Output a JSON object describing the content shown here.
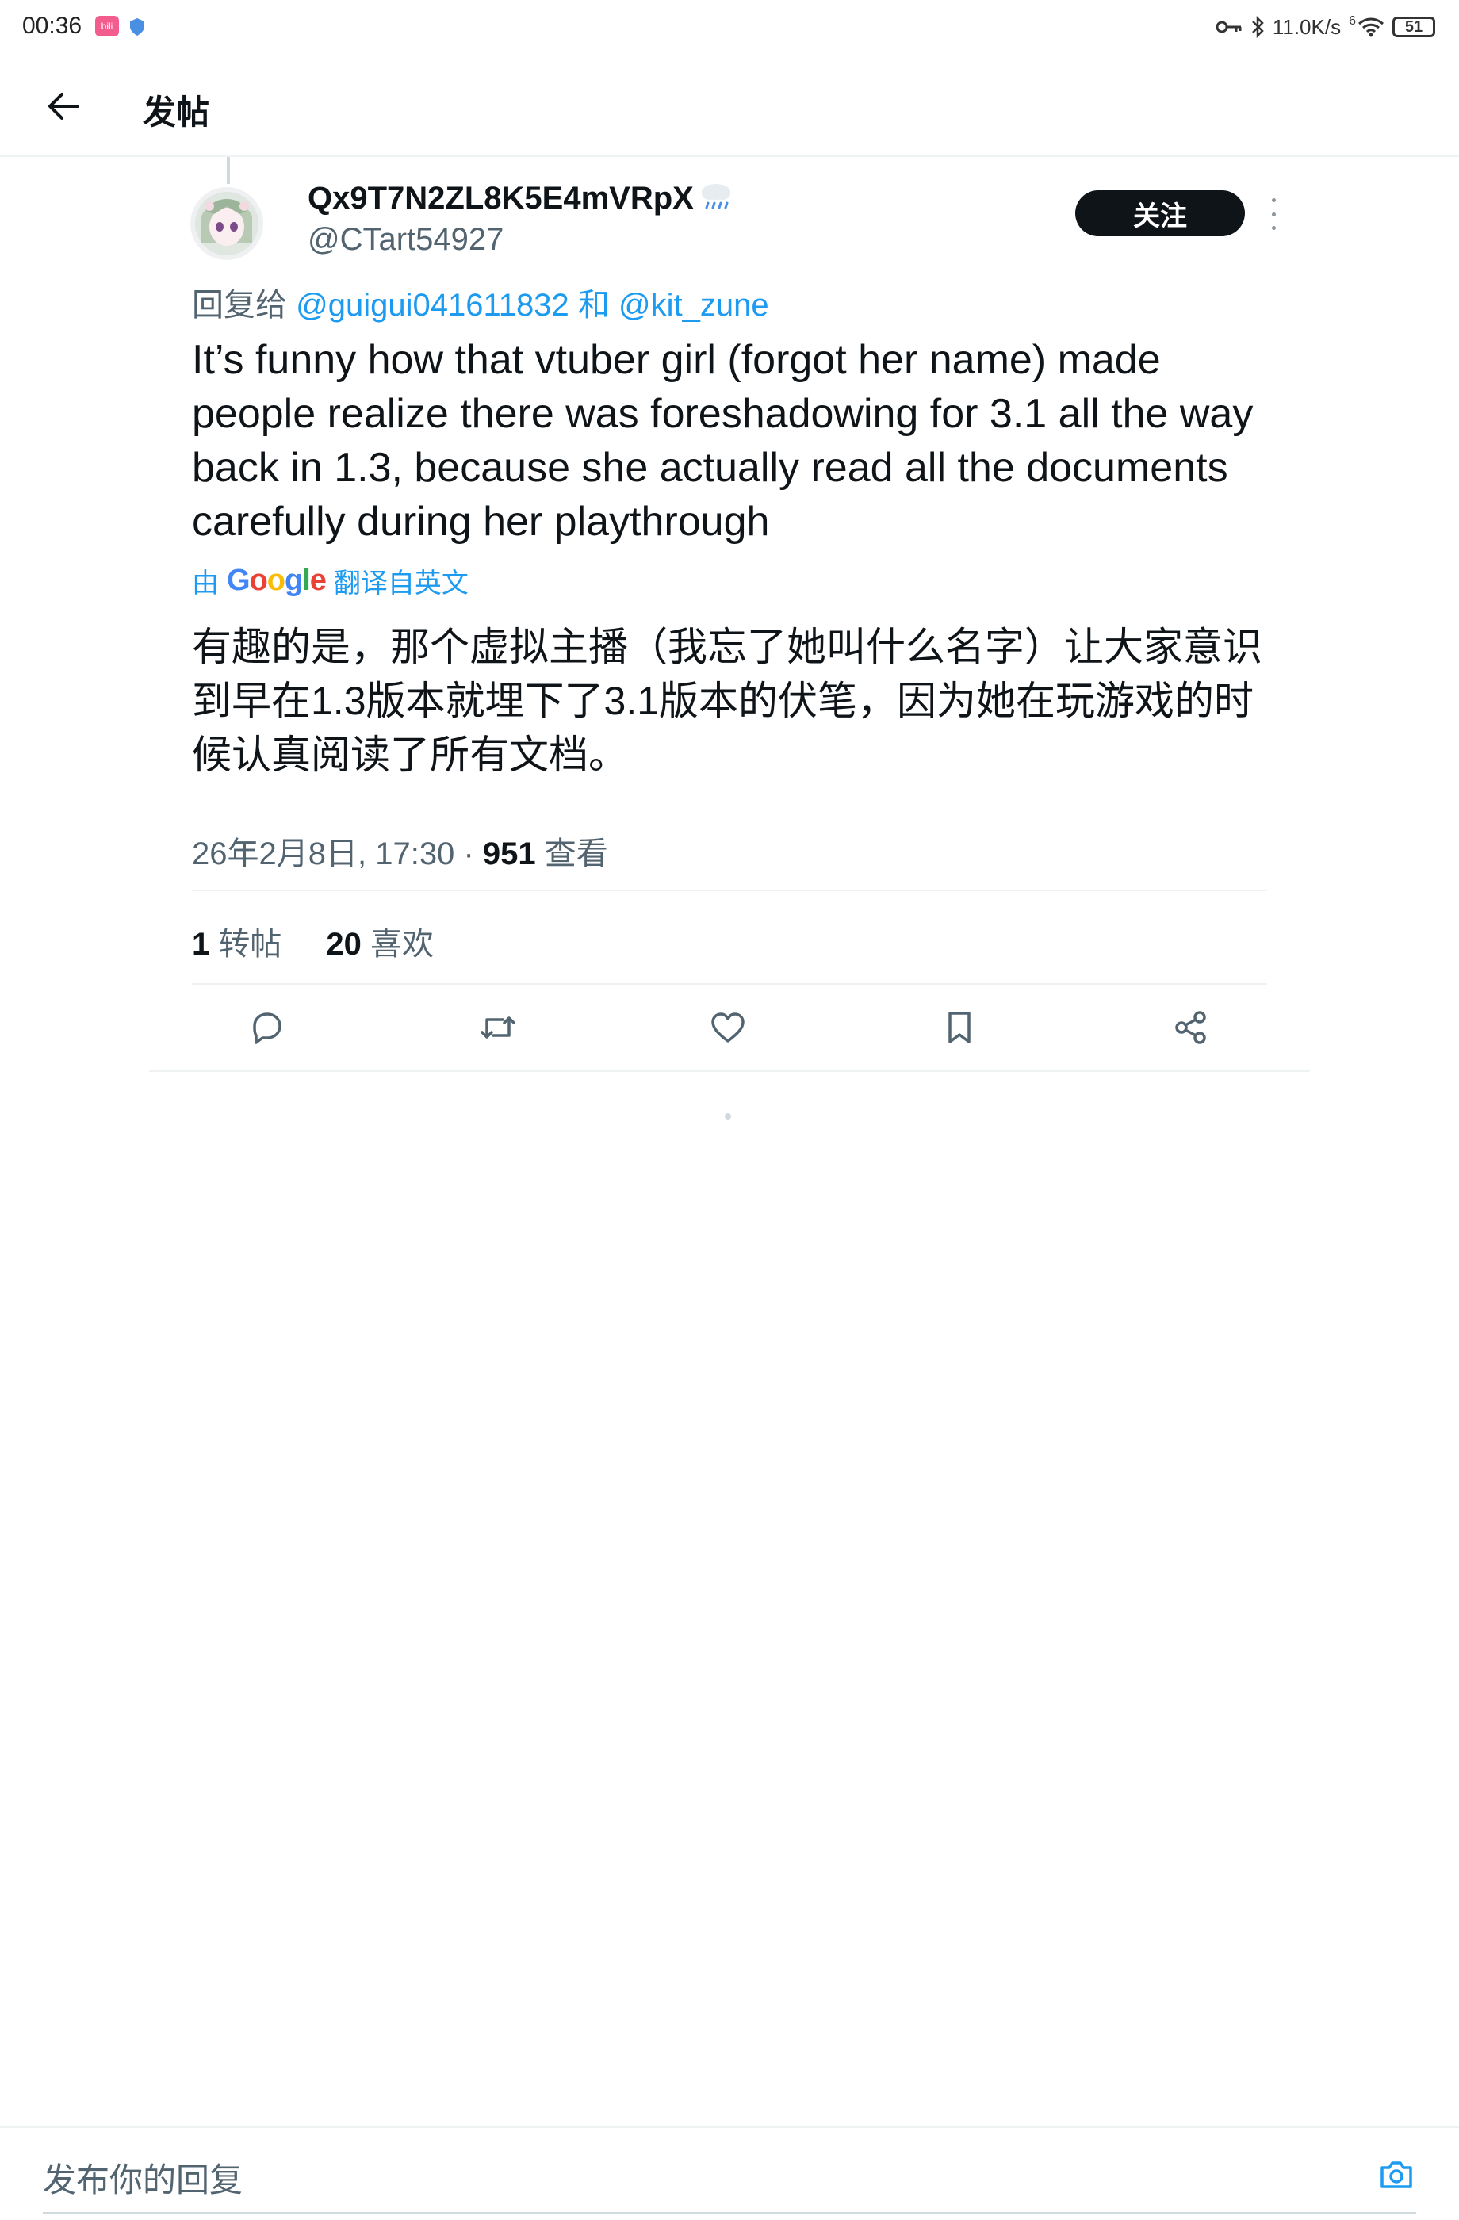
{
  "status_bar": {
    "time": "00:36",
    "app_badge": "bili",
    "network_speed": "11.0K/s",
    "signal_label": "6",
    "battery": "51"
  },
  "nav": {
    "title": "发帖"
  },
  "tweet": {
    "author": {
      "display_name": "Qx9T7N2ZL8K5E4mVRpX",
      "handle": "@CTart54927",
      "weather_emoji": "🌧️"
    },
    "follow_label": "关注",
    "reply_to": {
      "prefix": "回复给",
      "mention1": "@guigui041611832",
      "conjunction": "和",
      "mention2": "@kit_zune"
    },
    "text": "It’s funny how that vtuber girl (forgot her name) made people realize there was foreshadowing for 3.1 all the way back in 1.3, because she actually read all the documents carefully during her playthrough",
    "translation": {
      "by": "由",
      "google": "Google",
      "suffix": "翻译自英文",
      "text": "有趣的是，那个虚拟主播（我忘了她叫什么名字）让大家意识到早在1.3版本就埋下了3.1版本的伏笔，因为她在玩游戏的时候认真阅读了所有文档。"
    },
    "meta": {
      "datetime": "26年2月8日, 17:30",
      "separator": "·",
      "views_count": "951",
      "views_label": "查看"
    },
    "stats": {
      "retweets_count": "1",
      "retweets_label": "转帖",
      "likes_count": "20",
      "likes_label": "喜欢"
    }
  },
  "composer": {
    "placeholder": "发布你的回复"
  },
  "colors": {
    "accent": "#1d9bf0",
    "text_primary": "#0f1419",
    "text_secondary": "#536471"
  },
  "icons": [
    "back-arrow-icon",
    "more-icon",
    "reply-icon",
    "retweet-icon",
    "like-icon",
    "bookmark-icon",
    "share-icon",
    "camera-icon",
    "key-icon",
    "bluetooth-icon",
    "wifi-icon",
    "shield-icon"
  ]
}
